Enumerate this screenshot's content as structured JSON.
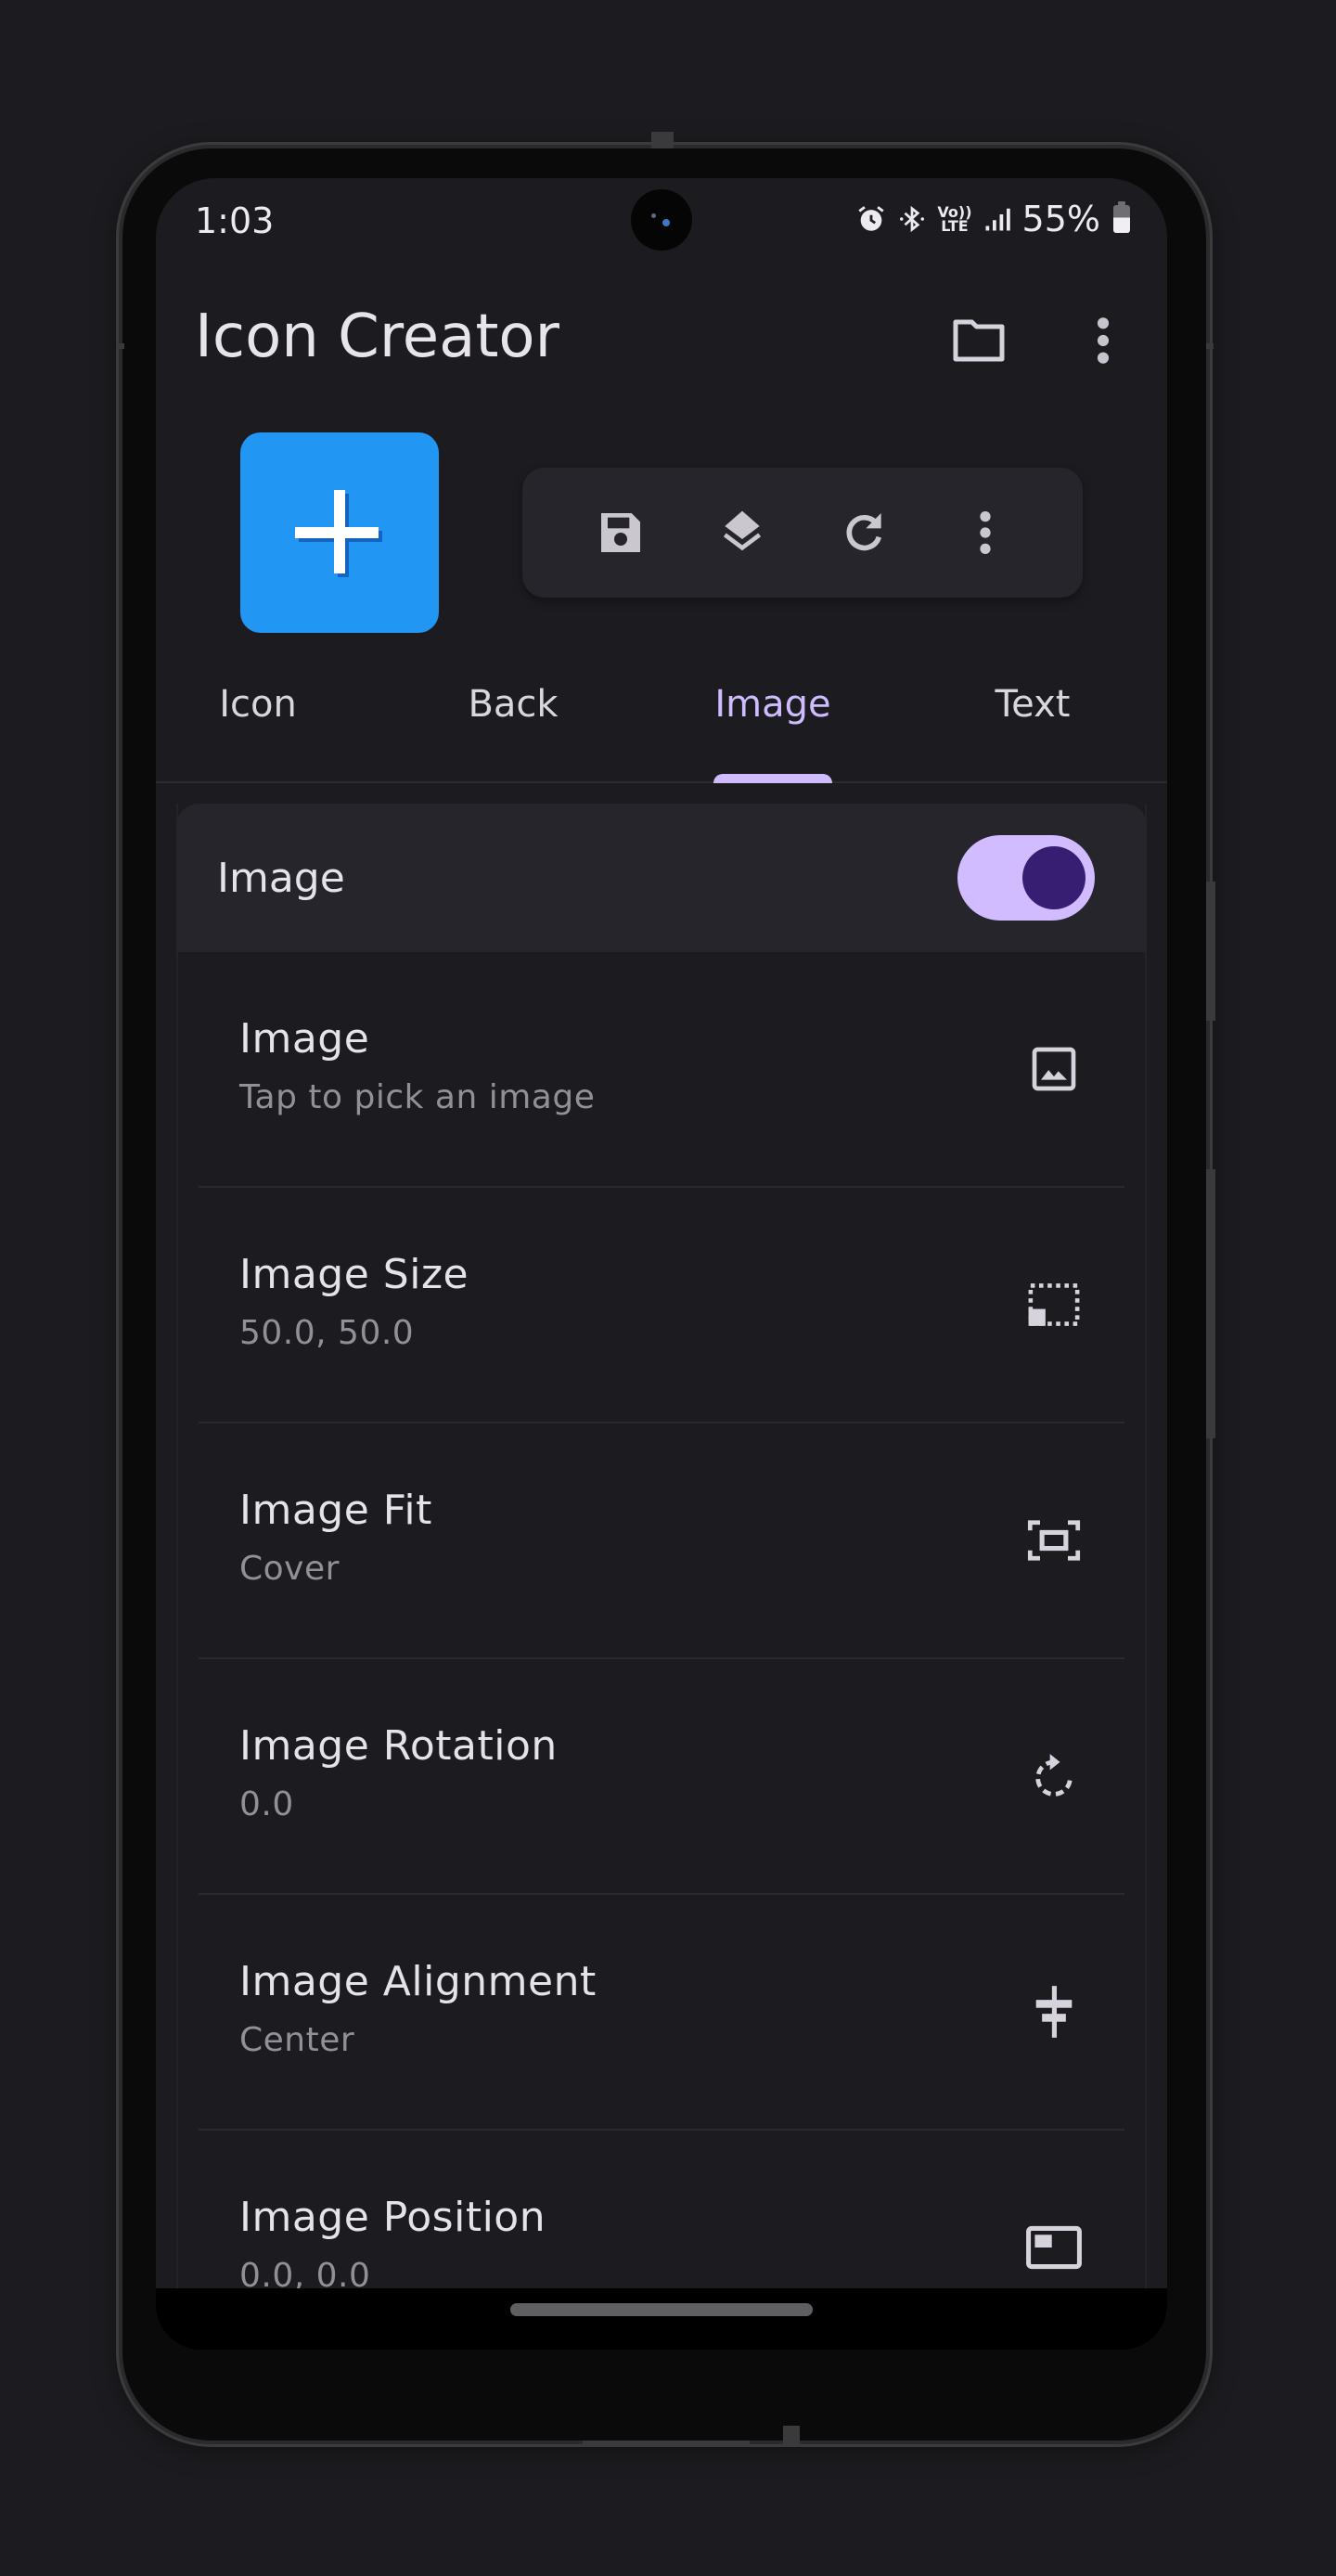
{
  "status_bar": {
    "time": "1:03",
    "icons": [
      "alarm-icon",
      "bluetooth-icon",
      "volte-icon",
      "signal-icon"
    ],
    "volte_top": "Vo))",
    "volte_bottom": "LTE",
    "battery_percent": "55%",
    "battery_level": 0.55
  },
  "app_bar": {
    "title": "Icon Creator",
    "actions": [
      "folder-icon",
      "more-vert-icon"
    ]
  },
  "preview": {
    "icon_glyph": "+",
    "background_color": "#2196f3",
    "toolbar_actions": [
      "save-icon",
      "layers-icon",
      "refresh-icon",
      "more-vert-icon"
    ]
  },
  "tabs": [
    {
      "label": "Icon",
      "active": false
    },
    {
      "label": "Back",
      "active": false
    },
    {
      "label": "Image",
      "active": true
    },
    {
      "label": "Text",
      "active": false
    }
  ],
  "section": {
    "title": "Image",
    "enabled": true,
    "items": [
      {
        "title": "Image",
        "subtitle": "Tap to pick an image",
        "icon": "image-icon"
      },
      {
        "title": "Image Size",
        "subtitle": "50.0, 50.0",
        "icon": "resize-icon"
      },
      {
        "title": "Image Fit",
        "subtitle": "Cover",
        "icon": "fit-screen-icon"
      },
      {
        "title": "Image Rotation",
        "subtitle": "0.0",
        "icon": "rotate-icon"
      },
      {
        "title": "Image Alignment",
        "subtitle": "Center",
        "icon": "align-center-icon"
      },
      {
        "title": "Image Position",
        "subtitle": "0.0, 0.0",
        "icon": "position-icon"
      }
    ]
  },
  "colors": {
    "accent": "#cfbcff",
    "switch_track": "#d0bcff",
    "switch_thumb": "#381e72",
    "background": "#1c1b20",
    "surface": "#26252b",
    "preview_blue": "#2196f3"
  }
}
